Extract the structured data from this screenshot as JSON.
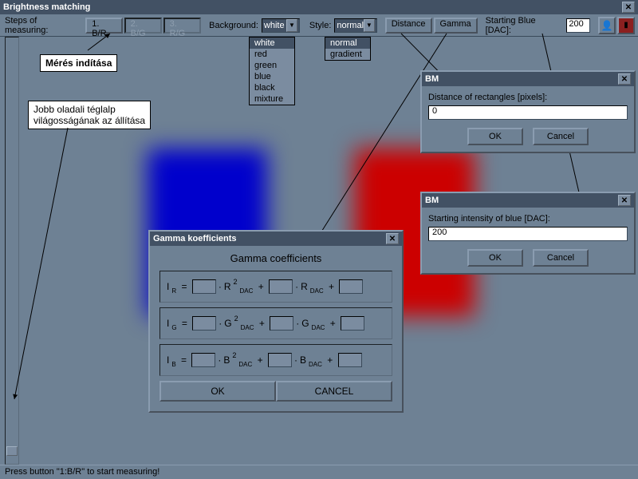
{
  "window": {
    "title": "Brightness matching"
  },
  "toolbar": {
    "steps_label": "Steps of measuring:",
    "steps": [
      {
        "label": "1. B/R",
        "active": true
      },
      {
        "label": "2. B/G",
        "active": false
      },
      {
        "label": "3. R/G",
        "active": false
      }
    ],
    "background_label": "Background:",
    "background_value": "white",
    "background_options": [
      "white",
      "red",
      "green",
      "blue",
      "black",
      "mixture"
    ],
    "style_label": "Style:",
    "style_value": "normal",
    "style_options": [
      "normal",
      "gradient"
    ],
    "distance_btn": "Distance",
    "gamma_btn": "Gamma",
    "starting_blue_label": "Starting Blue [DAC]:",
    "starting_blue_value": "200"
  },
  "annotations": {
    "start_measure": "Mérés indítása",
    "right_rect_brightness_l1": "Jobb oladali téglalp",
    "right_rect_brightness_l2": "világosságának az állítása"
  },
  "gamma_dialog": {
    "title": "Gamma koefficients",
    "header": "Gamma coefficients",
    "rows": [
      {
        "left": "I",
        "sub": "R",
        "var": "R"
      },
      {
        "left": "I",
        "sub": "G",
        "var": "G"
      },
      {
        "left": "I",
        "sub": "B",
        "var": "B"
      }
    ],
    "ok": "OK",
    "cancel": "CANCEL"
  },
  "distance_dialog": {
    "title": "BM",
    "label": "Distance of rectangles [pixels]:",
    "value": "0",
    "ok": "OK",
    "cancel": "Cancel"
  },
  "blue_dialog": {
    "title": "BM",
    "label": "Starting intensity of blue [DAC]:",
    "value": "200",
    "ok": "OK",
    "cancel": "Cancel"
  },
  "statusbar": {
    "text": "Press button \"1:B/R\" to start measuring!"
  }
}
